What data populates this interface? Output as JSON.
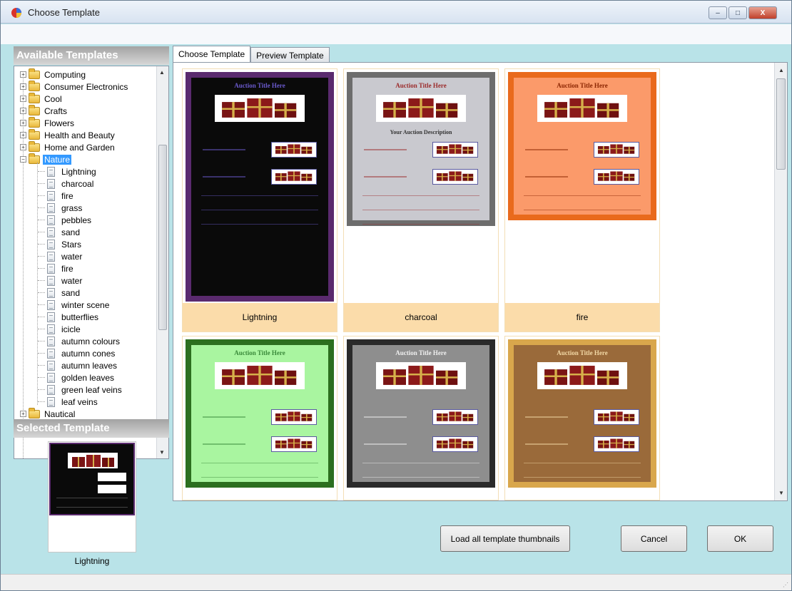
{
  "window": {
    "title": "Choose Template",
    "buttons": {
      "minimize": "–",
      "maximize": "□",
      "close": "X"
    }
  },
  "left_panel": {
    "available_header": "Available Templates",
    "selected_header": "Selected Template",
    "selected_template_caption": "Lightning",
    "categories": [
      {
        "label": "Computing",
        "expander": "+"
      },
      {
        "label": "Consumer Electronics",
        "expander": "+"
      },
      {
        "label": "Cool",
        "expander": "+"
      },
      {
        "label": "Crafts",
        "expander": "+"
      },
      {
        "label": "Flowers",
        "expander": "+"
      },
      {
        "label": "Health and Beauty",
        "expander": "+"
      },
      {
        "label": "Home and Garden",
        "expander": "+"
      },
      {
        "label": "Nature",
        "expander": "−",
        "selected": true
      }
    ],
    "nature_templates": [
      "Lightning",
      "charcoal",
      "fire",
      "grass",
      "pebbles",
      "sand",
      "Stars",
      "water",
      "fire",
      "water",
      "sand",
      "winter scene",
      "butterflies",
      "icicle",
      "autumn colours",
      "autumn cones",
      "autumn leaves",
      "golden leaves",
      "green leaf veins",
      "leaf veins"
    ],
    "partial_next_category": "Nautical"
  },
  "tabs": [
    {
      "label": "Choose Template",
      "active": true
    },
    {
      "label": "Preview Template",
      "active": false
    }
  ],
  "gallery": {
    "cards": [
      {
        "label": "Lightning",
        "bg": "#0a0a0a",
        "border": "#5a2a6e",
        "text": "#6a5acd",
        "title": "Auction Title Here"
      },
      {
        "label": "charcoal",
        "bg": "#c9c9cf",
        "border": "#6d6d6d",
        "text": "#9b2b2b",
        "title": "Auction Title Here",
        "subtitle": "Your Auction Description"
      },
      {
        "label": "fire",
        "bg": "#fb9a6a",
        "border": "#e96a1c",
        "text": "#8b2500",
        "title": "Auction Title Here"
      },
      {
        "label": "",
        "bg": "#a9f5a0",
        "border": "#2c6f1f",
        "text": "#3a8a3a",
        "title": "Auction Title Here"
      },
      {
        "label": "",
        "bg": "#8e8e8e",
        "border": "#2a2a2a",
        "text": "#f0f0f0",
        "title": "Auction Title Here"
      },
      {
        "label": "",
        "bg": "#9a6a3a",
        "border": "#d9a74c",
        "text": "#f3d9a6",
        "title": "Auction Title Here"
      }
    ]
  },
  "buttons": {
    "load_all": "Load all template thumbnails",
    "cancel": "Cancel",
    "ok": "OK"
  },
  "icons": {
    "app": "app-icon",
    "folder": "folder-icon",
    "document": "document-icon",
    "scroll_up": "▲",
    "scroll_down": "▼",
    "grip": "⋰"
  }
}
